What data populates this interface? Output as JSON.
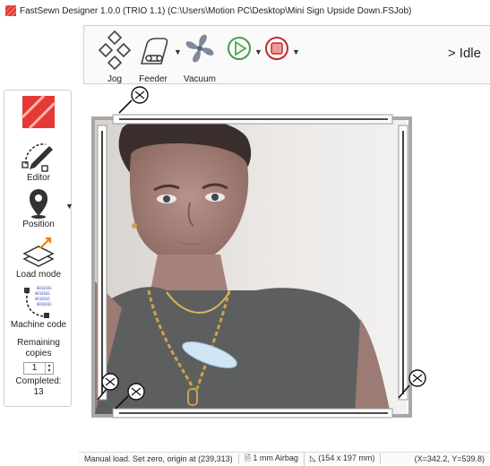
{
  "titlebar": {
    "title": "FastSewn Designer 1.0.0 (TRIO 1.1) (C:\\Users\\Motion PC\\Desktop\\Mini Sign Upside Down.FSJob)"
  },
  "toolbar": {
    "jog_label": "Jog",
    "feeder_label": "Feeder",
    "vacuum_label": "Vacuum",
    "status": "> Idle"
  },
  "sidebar": {
    "editor_label": "Editor",
    "position_label": "Position",
    "load_mode_label": "Load mode",
    "machine_code_label": "Machine code",
    "remaining_label": "Remaining copies",
    "copies_value": "1",
    "completed_label": "Completed:",
    "completed_value": "13"
  },
  "statusbar": {
    "message": "Manual load. Set zero, origin at (239,313)",
    "airbag": "1 mm Airbag",
    "size": "(154 x 197 mm)",
    "coords": "(X=342.2, Y=539.8)"
  },
  "colors": {
    "accent_red": "#e53935",
    "play_green": "#43a047",
    "stop_red": "#e53935",
    "frame_gray": "#a8a8a8"
  }
}
